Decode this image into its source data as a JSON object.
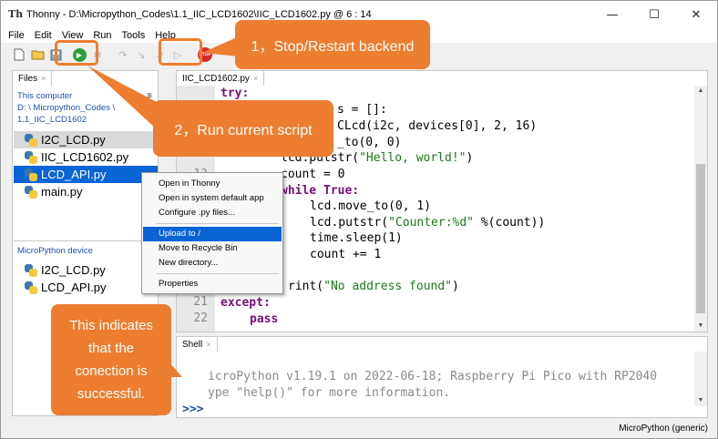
{
  "window": {
    "title": "Thonny  -  D:\\Micropython_Codes\\1.1_IIC_LCD1602\\IIC_LCD1602.py  @  6 : 14",
    "minimize": "—",
    "maximize": "☐",
    "close": "✕"
  },
  "menu": [
    "File",
    "Edit",
    "View",
    "Run",
    "Tools",
    "Help"
  ],
  "toolbar": {
    "stop_label": "STOP"
  },
  "files": {
    "tab": "Files",
    "computer_title": "This computer",
    "computer_path_1": "D: \\ Micropython_Codes \\",
    "computer_path_2": "1.1_IIC_LCD1602",
    "computer_files": [
      "I2C_LCD.py",
      "IIC_LCD1602.py",
      "LCD_API.py",
      "main.py"
    ],
    "device_title": "MicroPython device",
    "device_files": [
      "I2C_LCD.py",
      "LCD_API.py"
    ]
  },
  "editor": {
    "tab": "IIC_LCD1602.py",
    "line_numbers": [
      "13",
      "21",
      "22"
    ],
    "code": {
      "try": "try:",
      "l1": "s = []:",
      "l2": "CLcd(i2c, devices[0], 2, 16)",
      "l3": "_to(0, 0)",
      "l4a": "lcd.putstr(",
      "l4b": "\"Hello, world!\"",
      "l4c": ")",
      "l5": "count = 0",
      "l6": "while True:",
      "l7": "lcd.move_to(0, 1)",
      "l8a": "lcd.putstr(",
      "l8b": "\"Counter:%d\"",
      "l8c": " %(count))",
      "l9": "time.sleep(1)",
      "l10": "count += 1",
      "l11a": "rint(",
      "l11b": "\"No address found\"",
      "l11c": ")",
      "except": "except:",
      "pass": "pass"
    }
  },
  "shell": {
    "tab": "Shell",
    "line1": "icroPython v1.19.1 on 2022-06-18; Raspberry Pi Pico with RP2040",
    "line2": "ype \"help()\" for more information.",
    "prompt": ">>>"
  },
  "status": {
    "interpreter": "MicroPython (generic)"
  },
  "context_menu": {
    "items": [
      "Open in Thonny",
      "Open in system default app",
      "Configure .py files...",
      "Upload to /",
      "Move to Recycle Bin",
      "New directory...",
      "Properties"
    ]
  },
  "annotations": {
    "stop_callout": "1，Stop/Restart backend",
    "run_callout": "2，Run current script",
    "conn_line1": "This indicates",
    "conn_line2": "that the",
    "conn_line3": "conection is",
    "conn_line4": "successful."
  },
  "colors": {
    "accent": "#ed7d31",
    "selection": "#0a64d6"
  }
}
